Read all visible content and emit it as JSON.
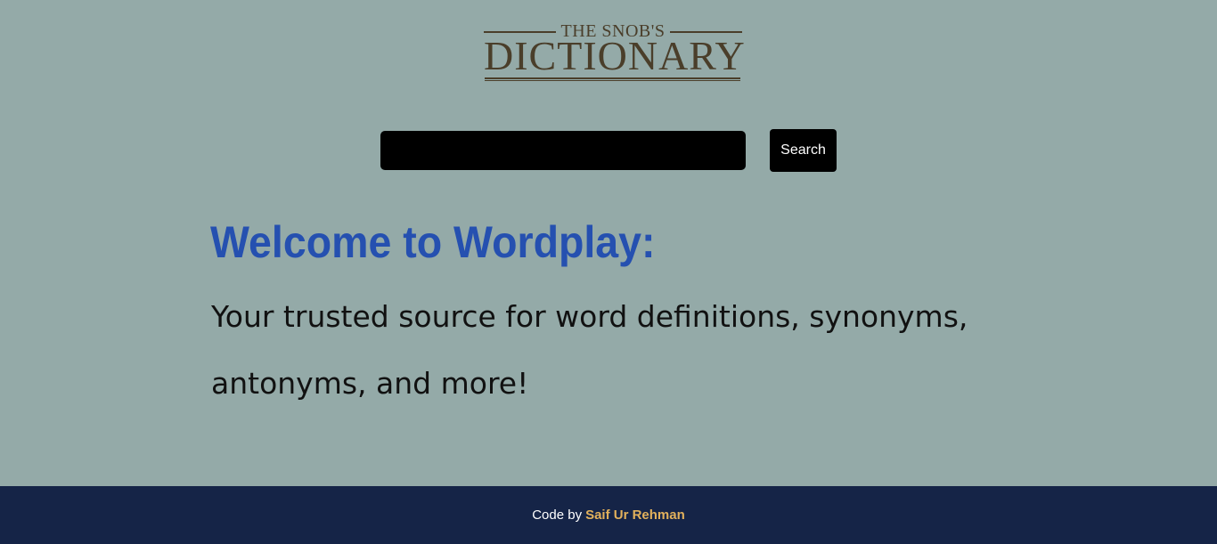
{
  "logo": {
    "top_text": "THE SNOB'S",
    "main_text": "DICTIONARY"
  },
  "search": {
    "value": "",
    "placeholder": "",
    "button_label": "Search"
  },
  "main": {
    "heading": "Welcome to Wordplay:",
    "tagline": "Your trusted source for word definitions, synonyms, antonyms, and more!"
  },
  "footer": {
    "prefix": "Code by",
    "author": "Saif Ur Rehman"
  },
  "colors": {
    "background": "#94aaa8",
    "heading": "#2550b0",
    "footer_bg": "#152447",
    "author_link": "#e2b15c",
    "logo": "#4a3e2a"
  }
}
